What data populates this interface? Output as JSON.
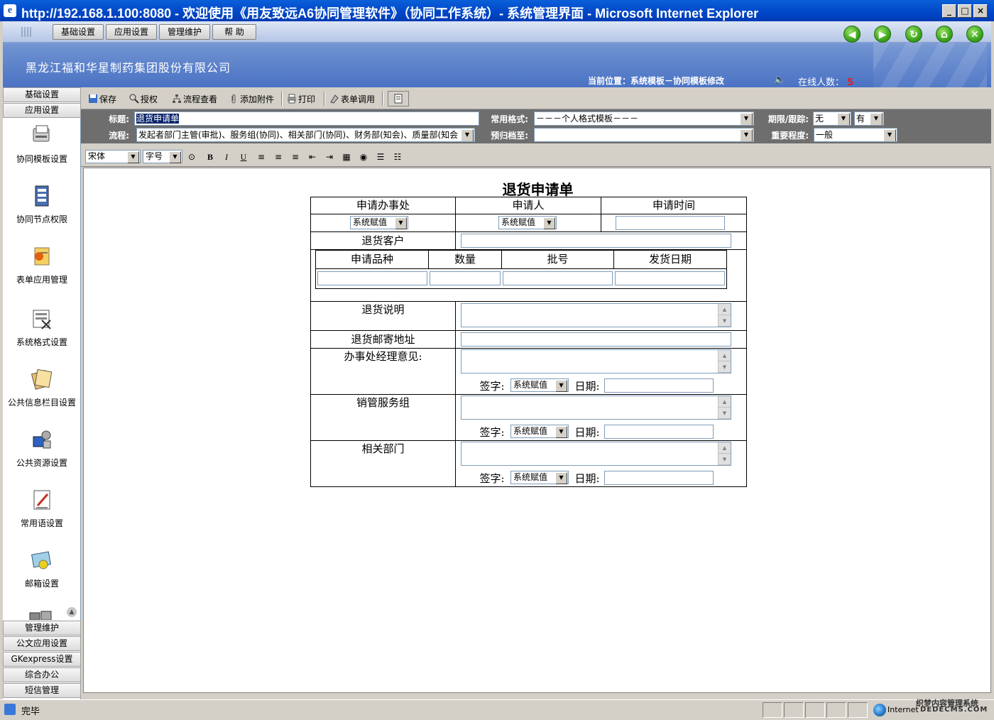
{
  "window": {
    "title": "http://192.168.1.100:8080 - 欢迎使用《用友致远A6协同管理软件》（协同工作系统）- 系统管理界面 - Microsoft Internet Explorer",
    "controls": [
      "_",
      "□",
      "×"
    ]
  },
  "topmenu": {
    "items": [
      "基础设置",
      "应用设置",
      "管理维护",
      "帮 助"
    ]
  },
  "nav_buttons": [
    "back-icon",
    "forward-icon",
    "refresh-icon",
    "home-icon",
    "close-icon"
  ],
  "header": {
    "company": "黑龙江福和华星制药集团股份有限公司",
    "location": "当前位置：系统模板－协同模板修改",
    "online_label": "在线人数：",
    "online_count": "5"
  },
  "sidebar": {
    "top_tabs": [
      "基础设置",
      "应用设置"
    ],
    "items": [
      {
        "label": "协同模板设置",
        "icon": "template-icon"
      },
      {
        "label": "协同节点权限",
        "icon": "node-permission-icon"
      },
      {
        "label": "表单应用管理",
        "icon": "form-app-icon"
      },
      {
        "label": "系统格式设置",
        "icon": "format-icon"
      },
      {
        "label": "公共信息栏目设置",
        "icon": "info-column-icon"
      },
      {
        "label": "公共资源设置",
        "icon": "resource-icon"
      },
      {
        "label": "常用语设置",
        "icon": "phrase-icon"
      },
      {
        "label": "邮箱设置",
        "icon": "mailbox-icon"
      }
    ],
    "bottom_tabs": [
      "管理维护",
      "公文应用设置",
      "GKexpress设置",
      "综合办公",
      "短信管理"
    ]
  },
  "toolbar": {
    "save": "保存",
    "authorize": "授权",
    "flow_view": "流程查看",
    "attach": "添加附件",
    "print": "打印",
    "form_call": "表单调用"
  },
  "form_header": {
    "title_label": "标题:",
    "title_value": "退货申请单",
    "flow_label": "流程:",
    "flow_value": "发起者部门主管(审批)、服务组(协同)、相关部门(协同)、财务部(知会)、质量部(知会",
    "format_label": "常用格式:",
    "format_value": "－－－个人格式模板－－－",
    "archive_label": "预归档至:",
    "archive_value": "",
    "deadline_label": "期限/跟踪:",
    "deadline_value": "无",
    "track_value": "有",
    "importance_label": "重要程度:",
    "importance_value": "一般"
  },
  "editor": {
    "font": "宋体",
    "size": "字号"
  },
  "document": {
    "title": "退货申请单",
    "office_label": "申请办事处",
    "applicant_label": "申请人",
    "time_label": "申请时间",
    "system_value": "系统赋值",
    "customer_label": "退货客户",
    "product_label": "申请品种",
    "qty_label": "数量",
    "batch_label": "批号",
    "ship_date_label": "发货日期",
    "desc_label": "退货说明",
    "address_label": "退货邮寄地址",
    "manager_label": "办事处经理意见:",
    "service_label": "销管服务组",
    "dept_label": "相关部门",
    "sign_label": "签字:",
    "date_label": "日期:"
  },
  "statusbar": {
    "text": "完毕",
    "zone": "Internet",
    "watermark": "织梦内容管理系统",
    "watermark2": "DEDECMS.COM"
  }
}
